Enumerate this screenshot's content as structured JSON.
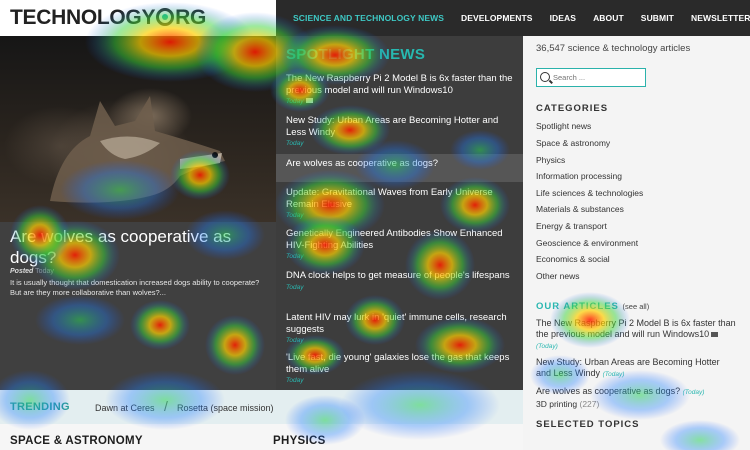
{
  "header": {
    "logo_text_a": "TECHNOLOGY",
    "logo_text_b": "RG",
    "nav": [
      {
        "label": "SCIENCE AND TECHNOLOGY NEWS",
        "active": true
      },
      {
        "label": "DEVELOPMENTS",
        "active": false
      },
      {
        "label": "IDEAS",
        "active": false
      },
      {
        "label": "ABOUT",
        "active": false
      },
      {
        "label": "SUBMIT",
        "active": false
      },
      {
        "label": "NEWSLETTER",
        "active": false
      }
    ]
  },
  "hero": {
    "title": "Are wolves as cooperative as dogs?",
    "posted_label": "Posted",
    "posted_when": "Today",
    "excerpt": "It is usually thought that domestication increased dogs ability to cooperate? But are they more collaborative than wolves?..."
  },
  "spotlight": {
    "title": "SPOTLIGHT NEWS",
    "items": [
      {
        "title": "The New Raspberry Pi 2 Model B is 6x faster than the previous model and will run Windows10",
        "date": "Today"
      },
      {
        "title": "New Study: Urban Areas are Becoming Hotter and Less Windy",
        "date": "Today"
      },
      {
        "title": "Are wolves as cooperative as dogs?",
        "date": ""
      },
      {
        "title": "Update: Gravitational Waves from Early Universe Remain Elusive",
        "date": "Today"
      },
      {
        "title": "Genetically Engineered Antibodies Show Enhanced HIV-Fighting Abilities",
        "date": "Today"
      },
      {
        "title": "DNA clock helps to get measure of people's lifespans",
        "date": "Today"
      },
      {
        "title": "Latent HIV may lurk in 'quiet' immune cells, research suggests",
        "date": "Today"
      },
      {
        "title": "'Live fast, die young' galaxies lose the gas that keeps them alive",
        "date": "Today"
      }
    ]
  },
  "sidebar": {
    "article_count": "36,547 science & technology articles",
    "search_placeholder": "Search ...",
    "categories_title": "CATEGORIES",
    "categories": [
      "Spotlight news",
      "Space & astronomy",
      "Physics",
      "Information processing",
      "Life sciences & technologies",
      "Materials & substances",
      "Energy & transport",
      "Geoscience & environment",
      "Economics & social",
      "Other news"
    ],
    "our_articles_title": "OUR ARTICLES",
    "see_all": "(see all)",
    "our_articles": [
      {
        "title": "The New Raspberry Pi 2 Model B is 6x faster than the previous model and will run Windows10",
        "date": "(Today)"
      },
      {
        "title": "New Study: Urban Areas are Becoming Hotter and Less Windy",
        "date": "(Today)"
      },
      {
        "title": "Are wolves as cooperative as dogs?",
        "date": "(Today)"
      }
    ],
    "selected_topics_title": "SELECTED TOPICS",
    "topic": "3D printing",
    "topic_count": "(227)"
  },
  "trending": {
    "label": "TRENDING",
    "links": [
      "Dawn at Ceres",
      "Rosetta (space mission)"
    ],
    "separator": "/"
  },
  "sections": [
    "SPACE & ASTRONOMY",
    "PHYSICS"
  ],
  "colors": {
    "accent": "#2ab7b0",
    "dark": "#2a2a2a"
  }
}
